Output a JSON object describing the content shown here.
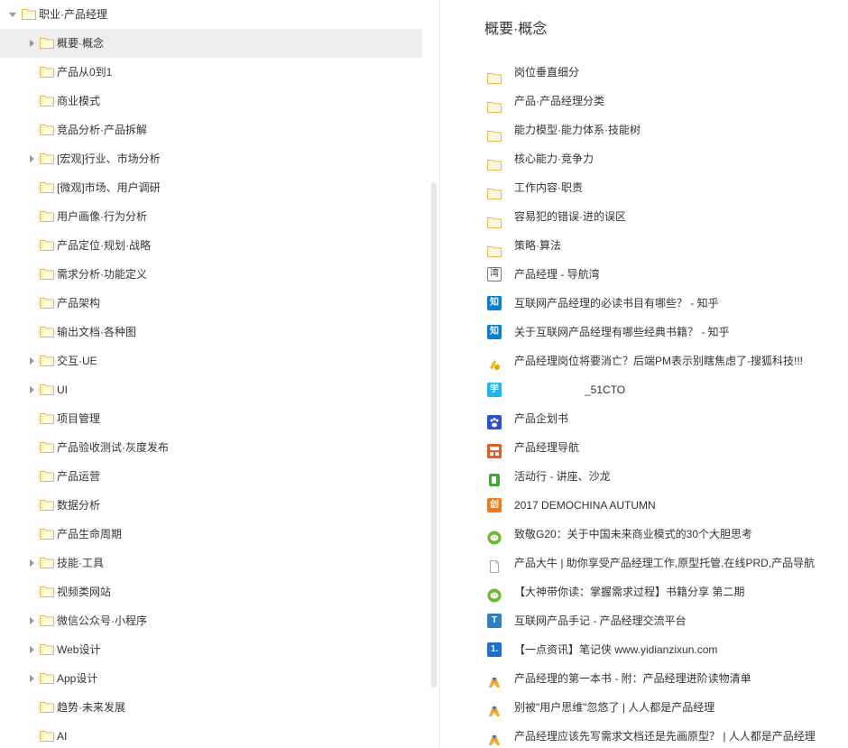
{
  "tree": {
    "root_label": "职业·产品经理",
    "items": [
      {
        "label": "概要·概念",
        "expandable": true,
        "selected": true
      },
      {
        "label": "产品从0到1",
        "expandable": false
      },
      {
        "label": "商业模式",
        "expandable": false
      },
      {
        "label": "竞品分析·产品拆解",
        "expandable": false
      },
      {
        "label": "[宏观]行业、市场分析",
        "expandable": true
      },
      {
        "label": "[微观]市场、用户调研",
        "expandable": false
      },
      {
        "label": "用户画像·行为分析",
        "expandable": false
      },
      {
        "label": "产品定位·规划·战略",
        "expandable": false
      },
      {
        "label": "需求分析·功能定义",
        "expandable": false
      },
      {
        "label": "产品架构",
        "expandable": false
      },
      {
        "label": "输出文档·各种图",
        "expandable": false
      },
      {
        "label": "交互·UE",
        "expandable": true
      },
      {
        "label": "UI",
        "expandable": true
      },
      {
        "label": "项目管理",
        "expandable": false
      },
      {
        "label": "产品验收测试·灰度发布",
        "expandable": false
      },
      {
        "label": "产品运营",
        "expandable": false
      },
      {
        "label": "数据分析",
        "expandable": false
      },
      {
        "label": "产品生命周期",
        "expandable": false
      },
      {
        "label": "技能·工具",
        "expandable": true
      },
      {
        "label": "视频类网站",
        "expandable": false
      },
      {
        "label": "微信公众号·小程序",
        "expandable": true
      },
      {
        "label": "Web设计",
        "expandable": true
      },
      {
        "label": "App设计",
        "expandable": true
      },
      {
        "label": "趋势·未来发展",
        "expandable": false
      },
      {
        "label": "AI",
        "expandable": false
      }
    ]
  },
  "content": {
    "title": "概要·概念",
    "items": [
      {
        "label": "岗位垂直细分",
        "icon": "folder-icon"
      },
      {
        "label": "产品·产品经理分类",
        "icon": "folder-icon"
      },
      {
        "label": "能力模型·能力体系·技能树",
        "icon": "folder-icon"
      },
      {
        "label": "核心能力·竞争力",
        "icon": "folder-icon"
      },
      {
        "label": "工作内容·职责",
        "icon": "folder-icon"
      },
      {
        "label": "容易犯的错误·进的误区",
        "icon": "folder-icon"
      },
      {
        "label": "策略·算法",
        "icon": "folder-icon"
      },
      {
        "label": "产品经理 - 导航湾",
        "icon": "daohangwan-icon",
        "glyph": "湾",
        "color": "#ffffff"
      },
      {
        "label": "互联网产品经理的必读书目有哪些？ - 知乎",
        "icon": "zhihu-icon",
        "glyph": "知",
        "color": "#0a7ed1"
      },
      {
        "label": "关于互联网产品经理有哪些经典书籍？ - 知乎",
        "icon": "zhihu-icon",
        "glyph": "知",
        "color": "#0a7ed1"
      },
      {
        "label": "产品经理岗位将要消亡？后端PM表示别瞎焦虑了-搜狐科技!!!",
        "icon": "sohu-icon",
        "glyph": "",
        "color": "#f5b400"
      },
      {
        "label": "_51CTO",
        "icon": "51cto-icon",
        "glyph": "学",
        "color": "#19b6f0"
      },
      {
        "label": "产品企划书",
        "icon": "baidu-paw-icon",
        "glyph": "",
        "color": "#2d4fd6"
      },
      {
        "label": "产品经理导航",
        "icon": "chanpin-icon",
        "glyph": "",
        "color": "#e25b28"
      },
      {
        "label": "活动行 - 讲座、沙龙",
        "icon": "huodongxing-icon",
        "glyph": "",
        "color": "#43a73b"
      },
      {
        "label": "2017 DEMOCHINA AUTUMN",
        "icon": "chuangye-icon",
        "glyph": "创",
        "color": "#f07a1a"
      },
      {
        "label": "致敬G20：关于中国未来商业模式的30个大胆思考",
        "icon": "wechat-icon",
        "glyph": "",
        "color": "#6bbb2a"
      },
      {
        "label": "产品大牛 | 助你享受产品经理工作,原型托管,在线PRD,产品导航",
        "icon": "page-icon",
        "glyph": "",
        "color": "#cccccc"
      },
      {
        "label": "【大神带你读：掌握需求过程】书籍分享 第二期",
        "icon": "wechat-icon",
        "glyph": "",
        "color": "#6bbb2a"
      },
      {
        "label": "互联网产品手记 - 产品经理交流平台",
        "icon": "t-logo-icon",
        "glyph": "T",
        "color": "#2f7fbf"
      },
      {
        "label": "【一点资讯】笔记侠 www.yidianzixun.com",
        "icon": "yidian-icon",
        "glyph": "1.",
        "color": "#1b6fd1"
      },
      {
        "label": "产品经理的第一本书 - 附：产品经理进阶读物清单",
        "icon": "woshipm-icon",
        "glyph": "",
        "color": "#f5a623"
      },
      {
        "label": "别被\"用户思维\"忽悠了 | 人人都是产品经理",
        "icon": "woshipm-icon",
        "glyph": "",
        "color": "#f5a623"
      },
      {
        "label": "产品经理应该先写需求文档还是先画原型？ | 人人都是产品经理",
        "icon": "woshipm-icon",
        "glyph": "",
        "color": "#f5a623"
      }
    ]
  }
}
